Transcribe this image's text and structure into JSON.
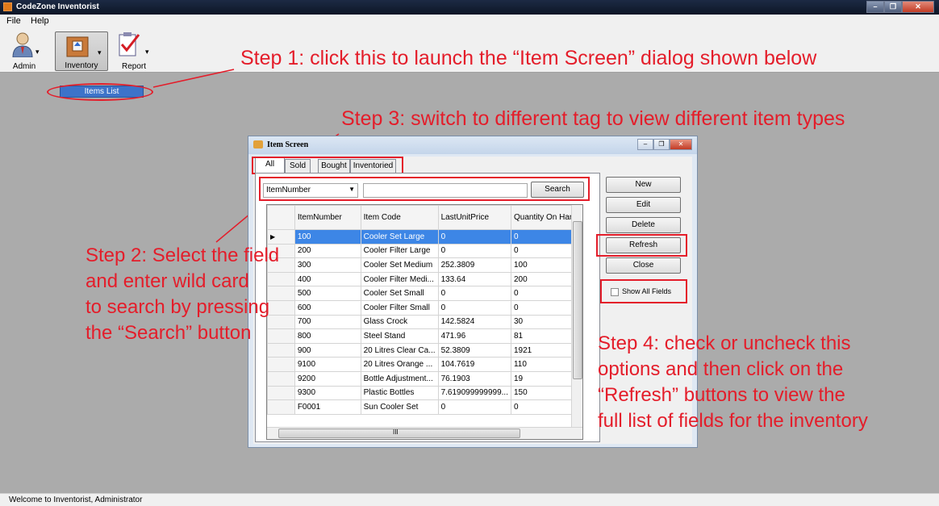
{
  "window": {
    "title": "CodeZone Inventorist",
    "controls": [
      "–",
      "❐",
      "✕"
    ]
  },
  "menu": [
    "File",
    "Help"
  ],
  "toolbar": {
    "admin": "Admin",
    "inventory": "Inventory",
    "report": "Report"
  },
  "dropdown": {
    "item": "Items List"
  },
  "status": "Welcome to Inventorist, Administrator",
  "annotations": {
    "step1": "Step 1: click this to launch the “Item Screen” dialog shown below",
    "step3": "Step 3: switch to different tag to view different item types",
    "step2": [
      "Step 2: Select the field",
      "and enter wild card",
      "to search by pressing",
      "the “Search” button"
    ],
    "step4": [
      "Step 4: check or uncheck this",
      "options and then click on the",
      "“Refresh” buttons to view the",
      "full list of fields for the inventory"
    ]
  },
  "dialog": {
    "title": "Item Screen",
    "tabs": [
      "All Items",
      "Sold",
      "Bought",
      "Inventoried"
    ],
    "search": {
      "field": "ItemNumber",
      "value": "",
      "button": "Search"
    },
    "columns": [
      "ItemNumber",
      "Item Code",
      "LastUnitPrice",
      "Quantity On Hand"
    ],
    "rows": [
      [
        "100",
        "Cooler Set Large",
        "0",
        "0"
      ],
      [
        "200",
        "Cooler Filter Large",
        "0",
        "0"
      ],
      [
        "300",
        "Cooler Set Medium",
        "252.3809",
        "100"
      ],
      [
        "400",
        "Cooler Filter Medi...",
        "133.64",
        "200"
      ],
      [
        "500",
        "Cooler Set Small",
        "0",
        "0"
      ],
      [
        "600",
        "Cooler Filter Small",
        "0",
        "0"
      ],
      [
        "700",
        "Glass Crock",
        "142.5824",
        "30"
      ],
      [
        "800",
        "Steel Stand",
        "471.96",
        "81"
      ],
      [
        "900",
        "20 Litres Clear Ca...",
        "52.3809",
        "1921"
      ],
      [
        "9100",
        "20 Litres Orange ...",
        "104.7619",
        "110"
      ],
      [
        "9200",
        "Bottle Adjustment...",
        "76.1903",
        "19"
      ],
      [
        "9300",
        "Plastic Bottles",
        "7.619099999999...",
        "150"
      ],
      [
        "F0001",
        "Sun Cooler Set",
        "0",
        "0"
      ]
    ],
    "buttons": [
      "New",
      "Edit",
      "Delete",
      "Refresh",
      "Close"
    ],
    "checkbox": "Show All Fields",
    "hscroll_mark": "III"
  }
}
